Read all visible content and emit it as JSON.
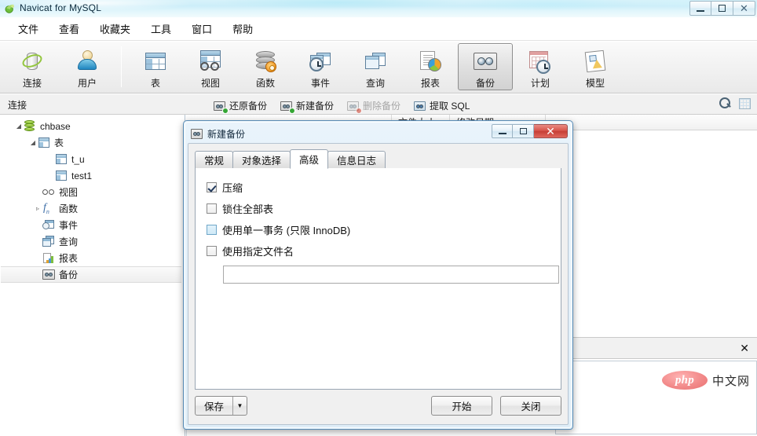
{
  "window": {
    "title": "Navicat for MySQL",
    "icon": "navicat-logo-icon",
    "controls": {
      "minimize": "–",
      "restore": "▣",
      "close": "✕"
    }
  },
  "menubar": {
    "items": [
      {
        "label": "文件",
        "name": "menu-file"
      },
      {
        "label": "查看",
        "name": "menu-view"
      },
      {
        "label": "收藏夹",
        "name": "menu-favorites"
      },
      {
        "label": "工具",
        "name": "menu-tools"
      },
      {
        "label": "窗口",
        "name": "menu-window"
      },
      {
        "label": "帮助",
        "name": "menu-help"
      }
    ]
  },
  "toolbar": {
    "items": [
      {
        "label": "连接",
        "icon": "connection-icon",
        "active": false
      },
      {
        "label": "用户",
        "icon": "user-icon",
        "active": false
      },
      {
        "label": "表",
        "icon": "table-icon",
        "active": false
      },
      {
        "label": "视图",
        "icon": "view-icon",
        "active": false
      },
      {
        "label": "函数",
        "icon": "function-icon",
        "active": false
      },
      {
        "label": "事件",
        "icon": "event-icon",
        "active": false
      },
      {
        "label": "查询",
        "icon": "query-icon",
        "active": false
      },
      {
        "label": "报表",
        "icon": "report-icon",
        "active": false
      },
      {
        "label": "备份",
        "icon": "backup-icon",
        "active": true
      },
      {
        "label": "计划",
        "icon": "schedule-icon",
        "active": false
      },
      {
        "label": "模型",
        "icon": "model-icon",
        "active": false
      }
    ]
  },
  "subbar": {
    "connection_label": "连接",
    "actions": [
      {
        "label": "还原备份",
        "icon": "restore-backup-icon",
        "disabled": false
      },
      {
        "label": "新建备份",
        "icon": "new-backup-icon",
        "disabled": false
      },
      {
        "label": "删除备份",
        "icon": "delete-backup-icon",
        "disabled": true
      },
      {
        "label": "提取 SQL",
        "icon": "extract-sql-icon",
        "disabled": false
      }
    ],
    "right_icons": [
      {
        "name": "search-icon"
      },
      {
        "name": "grid-view-icon"
      }
    ]
  },
  "tree": {
    "nodes": [
      {
        "label": "chbase",
        "icon": "database-icon",
        "indent": 18,
        "twist": "◢",
        "selected": false
      },
      {
        "label": "表",
        "icon": "table-icon",
        "indent": 36,
        "twist": "◢",
        "selected": false
      },
      {
        "label": "t_u",
        "icon": "table-icon",
        "indent": 70,
        "twist": "",
        "selected": false
      },
      {
        "label": "test1",
        "icon": "table-icon",
        "indent": 70,
        "twist": "",
        "selected": false
      },
      {
        "label": "视图",
        "icon": "view-glasses-icon",
        "indent": 54,
        "twist": "",
        "selected": false
      },
      {
        "label": "函数",
        "icon": "function-fx-icon",
        "indent": 54,
        "twist": "▹",
        "selected": false
      },
      {
        "label": "事件",
        "icon": "event-icon",
        "indent": 54,
        "twist": "",
        "selected": false
      },
      {
        "label": "查询",
        "icon": "query-icon",
        "indent": 54,
        "twist": "",
        "selected": false
      },
      {
        "label": "报表",
        "icon": "report-icon",
        "indent": 54,
        "twist": "",
        "selected": false
      },
      {
        "label": "备份",
        "icon": "backup-tape-icon",
        "indent": 54,
        "twist": "",
        "selected": true
      }
    ]
  },
  "list": {
    "columns": [
      {
        "label": "",
        "width": 60
      },
      {
        "label": "文件大小",
        "width": 74
      },
      {
        "label": "修改日期",
        "width": 122
      },
      {
        "label": "",
        "width": 60
      }
    ],
    "rows": []
  },
  "infostrip": {
    "close_label": "✕"
  },
  "watermark": {
    "logo": "php",
    "text": "中文网"
  },
  "dialog": {
    "title": "新建备份",
    "icon": "backup-tape-icon",
    "controls": {
      "minimize": "–",
      "restore": "□",
      "close": "✕"
    },
    "tabs": [
      {
        "label": "常规",
        "active": false
      },
      {
        "label": "对象选择",
        "active": false
      },
      {
        "label": "高级",
        "active": true
      },
      {
        "label": "信息日志",
        "active": false
      }
    ],
    "options": [
      {
        "label": "压缩",
        "checked": true,
        "tinted": false
      },
      {
        "label": "锁住全部表",
        "checked": false,
        "tinted": false
      },
      {
        "label": "使用单一事务 (只限 InnoDB)",
        "checked": false,
        "tinted": true
      },
      {
        "label": "使用指定文件名",
        "checked": false,
        "tinted": false
      }
    ],
    "filename_input": {
      "value": "",
      "placeholder": ""
    },
    "buttons": {
      "save": "保存",
      "save_arrow": "▼",
      "start": "开始",
      "close": "关闭"
    }
  }
}
